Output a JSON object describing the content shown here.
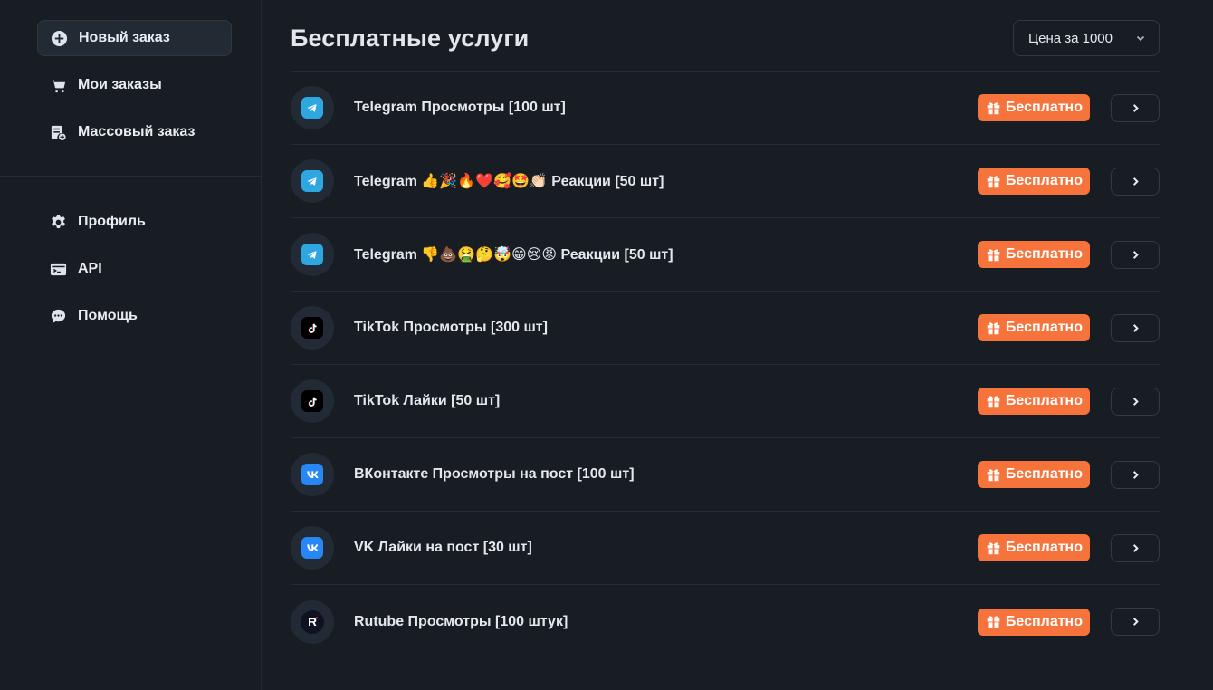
{
  "sidebar": {
    "primary": [
      {
        "label": "Новый заказ",
        "icon": "plus-circle-icon",
        "active": true
      },
      {
        "label": "Мои заказы",
        "icon": "cart-icon"
      },
      {
        "label": "Массовый заказ",
        "icon": "bulk-order-icon"
      }
    ],
    "secondary": [
      {
        "label": "Профиль",
        "icon": "gear-icon"
      },
      {
        "label": "API",
        "icon": "api-card-icon"
      },
      {
        "label": "Помощь",
        "icon": "chat-icon"
      }
    ]
  },
  "main": {
    "title": "Бесплатные услуги",
    "price_select": {
      "value": "Цена за 1000"
    },
    "badge_label": "Бесплатно",
    "services": [
      {
        "name": "Telegram Просмотры [100 шт]",
        "platform": "telegram-icon"
      },
      {
        "name": "Telegram 👍🎉🔥❤️🥰🤩👏🏻 Реакции [50 шт]",
        "platform": "telegram-icon"
      },
      {
        "name": "Telegram 👎💩🤮🤔🤯😁😢😡 Реакции [50 шт]",
        "platform": "telegram-icon"
      },
      {
        "name": "TikTok Просмотры [300 шт]",
        "platform": "tiktok-icon"
      },
      {
        "name": "TikTok Лайки [50 шт]",
        "platform": "tiktok-icon"
      },
      {
        "name": "ВКонтакте Просмотры на пост [100 шт]",
        "platform": "vk-icon"
      },
      {
        "name": "VK Лайки на пост [30 шт]",
        "platform": "vk-icon"
      },
      {
        "name": "Rutube Просмотры [100 штук]",
        "platform": "rutube-icon"
      }
    ]
  },
  "colors": {
    "background": "#181d24",
    "badge": "#f7733c",
    "telegram": "#2ea6e0",
    "vk": "#2787f5"
  }
}
